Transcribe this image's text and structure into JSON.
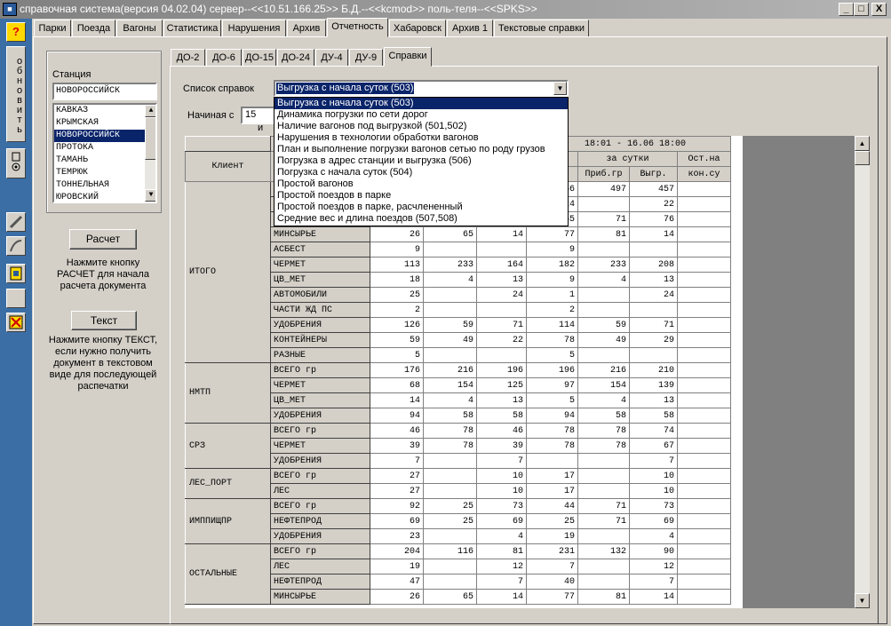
{
  "window": {
    "title": "справочная система(версия 04.02.04) сервер--<<10.51.166.25>> Б.Д.--<<kcmod>> поль-теля--<<SPKS>>",
    "minimize": "_",
    "maximize": "□",
    "close": "X"
  },
  "left_toolbar": {
    "help": "?",
    "refresh_vertical": "обновить"
  },
  "main_tabs": [
    "Парки",
    "Поезда",
    "Вагоны",
    "Статистика",
    "Нарушения",
    "Архив",
    "Отчетность",
    "Хабаровск",
    "Архив 1",
    "Текстовые справки"
  ],
  "main_tabs_selected": "Отчетность",
  "station": {
    "label": "Станция",
    "value": "НОВОРОССИЙСК",
    "list": [
      "КАВКАЗ",
      "КРЫМСКАЯ",
      "НОВОРОССИЙСК",
      "ПРОТОКА",
      "ТАМАНЬ",
      "ТЕМРЮК",
      "ТОННЕЛЬНАЯ",
      "ЮРОВСКИЙ"
    ],
    "selected": "НОВОРОССИЙСК"
  },
  "calc_button": "Расчет",
  "calc_note": "Нажмите кнопку РАСЧЕТ для начала расчета документа",
  "text_button": "Текст",
  "text_note": "Нажмите кнопку ТЕКСТ, если нужно получить документ в текстовом виде для последующей распечатки",
  "sub_tabs": [
    "ДО-2",
    "ДО-6",
    "ДО-15",
    "ДО-24",
    "ДУ-4",
    "ДУ-9",
    "Справки"
  ],
  "sub_tabs_selected": "Справки",
  "report_list": {
    "label": "Список справок",
    "value": "Выгрузка с начала суток (503)",
    "options": [
      "Выгрузка с начала суток (503)",
      "Динамика погрузки по сети дорог",
      "Наличие вагонов под выгрузкой (501,502)",
      "Нарушения в технологии обработки вагонов",
      "План и выполнение погрузки вагонов сетью по роду грузов",
      "Погрузка в адрес станции и выгрузка (506)",
      "Погрузка с начала суток (504)",
      "Простой вагонов",
      "Простой поездов в парке",
      "Простой поездов в парке, расчлененный",
      "Средние вес и длина поездов (507,508)"
    ]
  },
  "start_from": {
    "label": "Начиная с",
    "value": "15",
    "extra": "и"
  },
  "table": {
    "period_header": "18:01 - 16.06 18:00",
    "client_header": "Клиент",
    "partial_header": "а",
    "day_header": "за сутки",
    "rest_header": "Ост.на",
    "sub_headers": [
      "Приб.гр",
      "Выгр.",
      "кон.су"
    ],
    "top_rows": [
      {
        "c4": "66",
        "c5": "497",
        "c6": "457",
        "c7": ""
      },
      {
        "c4": "24",
        "c5": "",
        "c6": "22",
        "c7": ""
      },
      {
        "c4": "65",
        "c5": "71",
        "c6": "76",
        "c7": ""
      }
    ],
    "groups": [
      {
        "name": "ИТОГО",
        "rows": [
          {
            "cargo": "МИНСЫРЬЕ",
            "v": [
              "26",
              "65",
              "14",
              "77",
              "81",
              "14",
              ""
            ]
          },
          {
            "cargo": "АСБЕСТ",
            "v": [
              "9",
              "",
              "",
              "9",
              "",
              "",
              ""
            ]
          },
          {
            "cargo": "ЧЕРМЕТ",
            "v": [
              "113",
              "233",
              "164",
              "182",
              "233",
              "208",
              ""
            ]
          },
          {
            "cargo": "ЦВ_МЕТ",
            "v": [
              "18",
              "4",
              "13",
              "9",
              "4",
              "13",
              ""
            ]
          },
          {
            "cargo": "АВТОМОБИЛИ",
            "v": [
              "25",
              "",
              "24",
              "1",
              "",
              "24",
              ""
            ]
          },
          {
            "cargo": "ЧАСТИ ЖД ПС",
            "v": [
              "2",
              "",
              "",
              "2",
              "",
              "",
              ""
            ]
          },
          {
            "cargo": "УДОБРЕНИЯ",
            "v": [
              "126",
              "59",
              "71",
              "114",
              "59",
              "71",
              ""
            ]
          },
          {
            "cargo": "КОНТЕЙНЕРЫ",
            "v": [
              "59",
              "49",
              "22",
              "78",
              "49",
              "29",
              ""
            ]
          },
          {
            "cargo": "РАЗНЫЕ",
            "v": [
              "5",
              "",
              "",
              "5",
              "",
              "",
              ""
            ]
          }
        ]
      },
      {
        "name": "НМТП",
        "rows": [
          {
            "cargo": "ВСЕГО   гр",
            "v": [
              "176",
              "216",
              "196",
              "196",
              "216",
              "210",
              ""
            ]
          },
          {
            "cargo": "ЧЕРМЕТ",
            "v": [
              "68",
              "154",
              "125",
              "97",
              "154",
              "139",
              ""
            ]
          },
          {
            "cargo": "ЦВ_МЕТ",
            "v": [
              "14",
              "4",
              "13",
              "5",
              "4",
              "13",
              ""
            ]
          },
          {
            "cargo": "УДОБРЕНИЯ",
            "v": [
              "94",
              "58",
              "58",
              "94",
              "58",
              "58",
              ""
            ]
          }
        ]
      },
      {
        "name": "СРЗ",
        "rows": [
          {
            "cargo": "ВСЕГО   гр",
            "v": [
              "46",
              "78",
              "46",
              "78",
              "78",
              "74",
              ""
            ]
          },
          {
            "cargo": "ЧЕРМЕТ",
            "v": [
              "39",
              "78",
              "39",
              "78",
              "78",
              "67",
              ""
            ]
          },
          {
            "cargo": "УДОБРЕНИЯ",
            "v": [
              "7",
              "",
              "7",
              "",
              "",
              "7",
              ""
            ]
          }
        ]
      },
      {
        "name": "ЛЕС_ПОРТ",
        "rows": [
          {
            "cargo": "ВСЕГО   гр",
            "v": [
              "27",
              "",
              "10",
              "17",
              "",
              "10",
              ""
            ]
          },
          {
            "cargo": "ЛЕС",
            "v": [
              "27",
              "",
              "10",
              "17",
              "",
              "10",
              ""
            ]
          }
        ]
      },
      {
        "name": "ИМППИЩПР",
        "rows": [
          {
            "cargo": "ВСЕГО   гр",
            "v": [
              "92",
              "25",
              "73",
              "44",
              "71",
              "73",
              ""
            ]
          },
          {
            "cargo": "НЕФТЕПРОД",
            "v": [
              "69",
              "25",
              "69",
              "25",
              "71",
              "69",
              ""
            ]
          },
          {
            "cargo": "УДОБРЕНИЯ",
            "v": [
              "23",
              "",
              "4",
              "19",
              "",
              "4",
              ""
            ]
          }
        ]
      },
      {
        "name": "ОСТАЛЬНЫЕ",
        "rows": [
          {
            "cargo": "ВСЕГО   гр",
            "v": [
              "204",
              "116",
              "81",
              "231",
              "132",
              "90",
              ""
            ]
          },
          {
            "cargo": "ЛЕС",
            "v": [
              "19",
              "",
              "12",
              "7",
              "",
              "12",
              ""
            ]
          },
          {
            "cargo": "НЕФТЕПРОД",
            "v": [
              "47",
              "",
              "7",
              "40",
              "",
              "7",
              ""
            ]
          },
          {
            "cargo": "МИНСЫРЬЕ",
            "v": [
              "26",
              "65",
              "14",
              "77",
              "81",
              "14",
              ""
            ]
          }
        ]
      }
    ]
  },
  "scroll": {
    "up": "▲",
    "down": "▼"
  }
}
